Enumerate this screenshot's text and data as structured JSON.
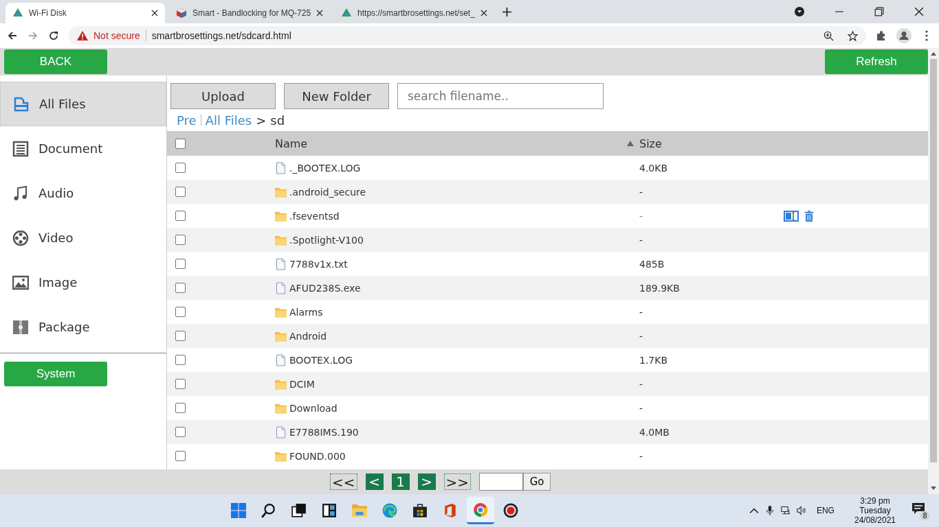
{
  "browser": {
    "tabs": [
      {
        "title": "Wi-Fi Disk",
        "selected": true,
        "kind": "drive"
      },
      {
        "title": "Smart - Bandlocking for MQ-725",
        "selected": false,
        "kind": "cube"
      },
      {
        "title": "https://smartbrosettings.net/set_",
        "selected": false,
        "kind": "drive"
      }
    ],
    "security": "Not secure",
    "url": "smartbrosettings.net/sdcard.html"
  },
  "topbar": {
    "back": "BACK",
    "refresh": "Refresh"
  },
  "sidebar": {
    "items": [
      {
        "label": "All Files",
        "kind": "files",
        "selected": true
      },
      {
        "label": "Document",
        "kind": "document",
        "selected": false
      },
      {
        "label": "Audio",
        "kind": "audio",
        "selected": false
      },
      {
        "label": "Video",
        "kind": "video",
        "selected": false
      },
      {
        "label": "Image",
        "kind": "image",
        "selected": false
      },
      {
        "label": "Package",
        "kind": "package",
        "selected": false
      }
    ],
    "system": "System"
  },
  "toolbar": {
    "upload": "Upload",
    "new_folder": "New Folder",
    "search_placeholder": "search filename.."
  },
  "breadcrumb": {
    "pre": "Pre",
    "link": "All Files",
    "sep": ">",
    "current": "sd"
  },
  "table": {
    "columns": [
      "Name",
      "Size"
    ],
    "header_checked": false,
    "rows": [
      {
        "name": "._BOOTEX.LOG",
        "kind": "file",
        "size": "4.0KB",
        "checked": false,
        "hovered": false
      },
      {
        "name": ".android_secure",
        "kind": "folder",
        "size": "-",
        "checked": false,
        "hovered": false
      },
      {
        "name": ".fseventsd",
        "kind": "folder",
        "size": "-",
        "checked": false,
        "hovered": true
      },
      {
        "name": ".Spotlight-V100",
        "kind": "folder",
        "size": "-",
        "checked": false,
        "hovered": false
      },
      {
        "name": "7788v1x.txt",
        "kind": "file",
        "size": "485B",
        "checked": false,
        "hovered": false
      },
      {
        "name": "AFUD238S.exe",
        "kind": "file",
        "size": "189.9KB",
        "checked": false,
        "hovered": false
      },
      {
        "name": "Alarms",
        "kind": "folder",
        "size": "-",
        "checked": false,
        "hovered": false
      },
      {
        "name": "Android",
        "kind": "folder",
        "size": "-",
        "checked": false,
        "hovered": false
      },
      {
        "name": "BOOTEX.LOG",
        "kind": "file",
        "size": "1.7KB",
        "checked": false,
        "hovered": false
      },
      {
        "name": "DCIM",
        "kind": "folder",
        "size": "-",
        "checked": false,
        "hovered": false
      },
      {
        "name": "Download",
        "kind": "folder",
        "size": "-",
        "checked": false,
        "hovered": false
      },
      {
        "name": "E7788IMS.190",
        "kind": "file",
        "size": "4.0MB",
        "checked": false,
        "hovered": false
      },
      {
        "name": "FOUND.000",
        "kind": "folder",
        "size": "-",
        "checked": false,
        "hovered": false
      }
    ]
  },
  "pager": {
    "buttons": [
      {
        "label": "<<",
        "disabled": true
      },
      {
        "label": "<",
        "disabled": false
      },
      {
        "label": "1",
        "disabled": false
      },
      {
        "label": ">",
        "disabled": false
      },
      {
        "label": ">>",
        "disabled": true
      }
    ],
    "go": "Go"
  },
  "taskbar": {
    "apps": [
      {
        "kind": "start",
        "active": false
      },
      {
        "kind": "search",
        "active": false
      },
      {
        "kind": "taskview",
        "active": false
      },
      {
        "kind": "widgets",
        "active": false
      },
      {
        "kind": "folder",
        "active": false
      },
      {
        "kind": "edge",
        "active": false
      },
      {
        "kind": "store",
        "active": false
      },
      {
        "kind": "office",
        "active": false
      },
      {
        "kind": "chrome",
        "active": true
      },
      {
        "kind": "record",
        "active": false
      }
    ],
    "language": "ENG",
    "time": "3:29 pm",
    "day": "Tuesday",
    "date": "24/08/2021",
    "notifications": "8"
  }
}
